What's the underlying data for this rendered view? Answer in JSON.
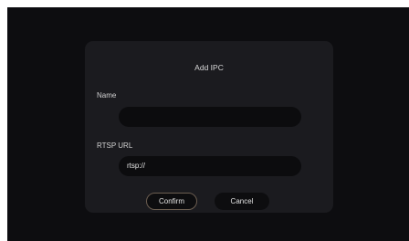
{
  "dialog": {
    "title": "Add IPC",
    "name_label": "Name",
    "name_value": "",
    "rtsp_label": "RTSP URL",
    "rtsp_value": "rtsp://",
    "confirm_label": "Confirm",
    "cancel_label": "Cancel"
  },
  "colors": {
    "backdrop": "#0d0d10",
    "dialog": "#1b1b1f",
    "field": "#0c0c0e",
    "confirm_border": "#6b5d50"
  }
}
